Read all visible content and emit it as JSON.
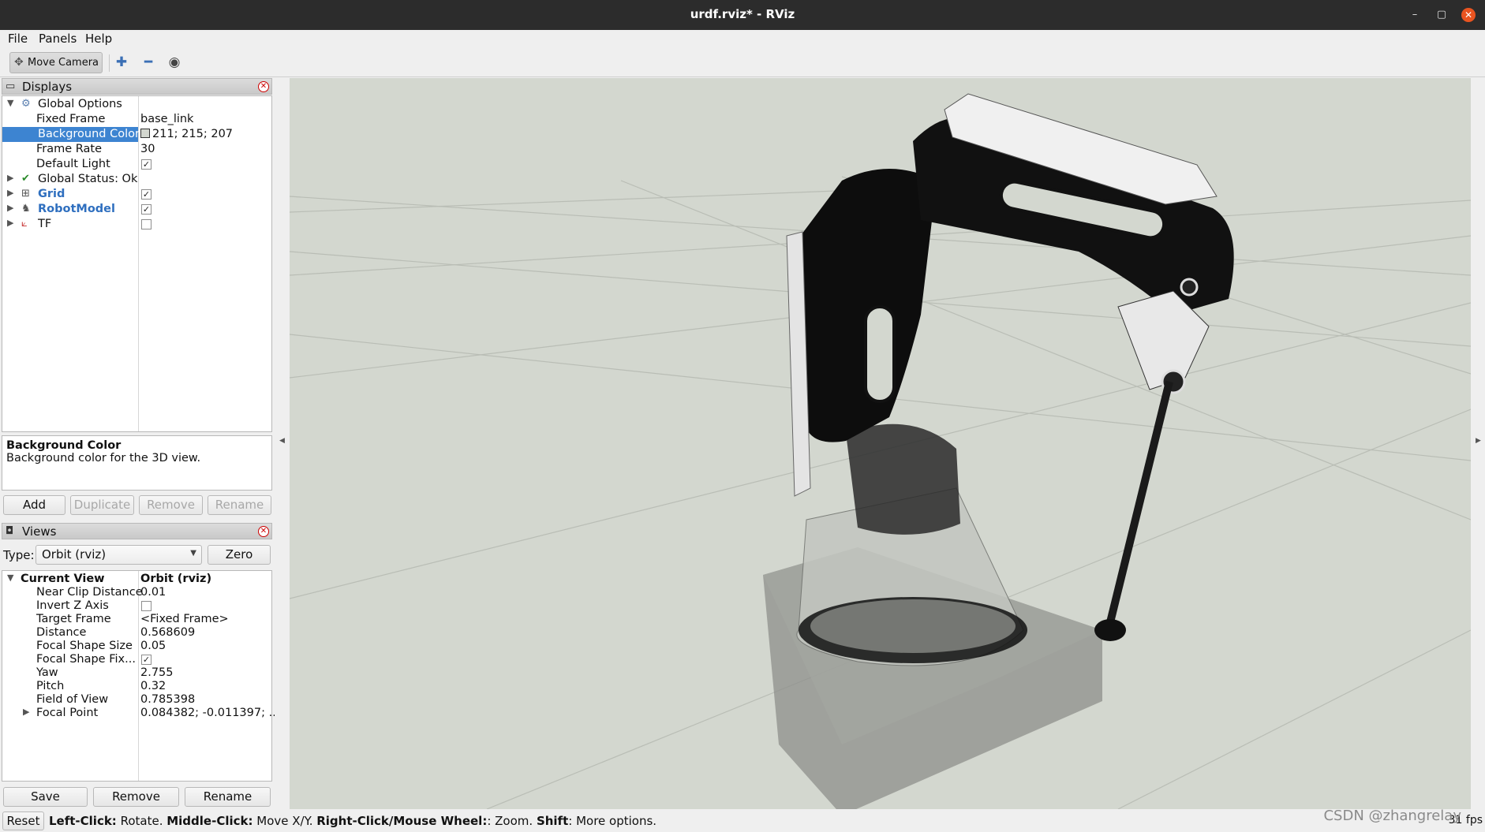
{
  "window": {
    "title": "urdf.rviz* - RViz",
    "minimize_glyph": "–",
    "maximize_glyph": "▢",
    "close_glyph": "✕"
  },
  "menu": [
    "File",
    "Panels",
    "Help"
  ],
  "toolbar": {
    "move_camera": "Move Camera",
    "icons": [
      "move-camera-icon",
      "add-tool-icon",
      "remove-tool-icon",
      "eye-icon"
    ]
  },
  "displays": {
    "title": "Displays",
    "global_options": {
      "label": "Global Options",
      "fixed_frame_key": "Fixed Frame",
      "fixed_frame": "base_link",
      "background_color_key": "Background Color",
      "background_color": "211; 215; 207",
      "frame_rate_key": "Frame Rate",
      "frame_rate": "30",
      "default_light_key": "Default Light",
      "default_light": true
    },
    "global_status": "Global Status: Ok",
    "items": [
      {
        "name": "Grid",
        "checked": true
      },
      {
        "name": "RobotModel",
        "checked": true
      },
      {
        "name": "TF",
        "checked": false
      }
    ],
    "description_title": "Background Color",
    "description_text": "Background color for the 3D view.",
    "buttons": {
      "add": "Add",
      "duplicate": "Duplicate",
      "remove": "Remove",
      "rename": "Rename"
    }
  },
  "views": {
    "title": "Views",
    "type_label": "Type:",
    "type_value": "Orbit (rviz)",
    "zero": "Zero",
    "current_view_key": "Current View",
    "current_view_value": "Orbit (rviz)",
    "props": [
      {
        "k": "Near Clip Distance",
        "v": "0.01"
      },
      {
        "k": "Invert Z Axis",
        "v": "",
        "checkbox": false
      },
      {
        "k": "Target Frame",
        "v": "<Fixed Frame>"
      },
      {
        "k": "Distance",
        "v": "0.568609"
      },
      {
        "k": "Focal Shape Size",
        "v": "0.05"
      },
      {
        "k": "Focal Shape Fix...",
        "v": "",
        "checkbox": true
      },
      {
        "k": "Yaw",
        "v": "2.755"
      },
      {
        "k": "Pitch",
        "v": "0.32"
      },
      {
        "k": "Field of View",
        "v": "0.785398"
      },
      {
        "k": "Focal Point",
        "v": "0.084382; -0.011397; ..."
      }
    ],
    "buttons": {
      "save": "Save",
      "remove": "Remove",
      "rename": "Rename"
    }
  },
  "status": {
    "reset": "Reset",
    "b1": "Left-Click:",
    "t1": " Rotate. ",
    "b2": "Middle-Click:",
    "t2": " Move X/Y. ",
    "b3": "Right-Click/Mouse Wheel:",
    "t3": ": Zoom. ",
    "b4": "Shift",
    "t4": ": More options.",
    "fps": "31 fps"
  },
  "watermark": "CSDN @zhangrelay",
  "colors": {
    "background": "#d3d7cf",
    "selection": "#3d84d1",
    "close": "#e95420"
  }
}
